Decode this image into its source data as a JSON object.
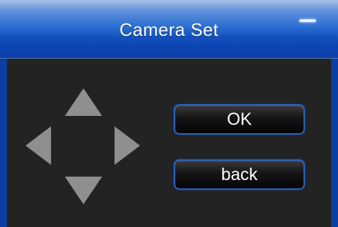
{
  "window": {
    "title": "Camera Set",
    "minimize_icon": "minimize-icon"
  },
  "dpad": {
    "up_icon": "arrow-up-icon",
    "down_icon": "arrow-down-icon",
    "left_icon": "arrow-left-icon",
    "right_icon": "arrow-right-icon"
  },
  "buttons": {
    "ok_label": "OK",
    "back_label": "back"
  },
  "colors": {
    "title_bar": "#1552bf",
    "background": "#232323",
    "button_border": "#2b64c4",
    "arrow": "#8f8f8f"
  }
}
